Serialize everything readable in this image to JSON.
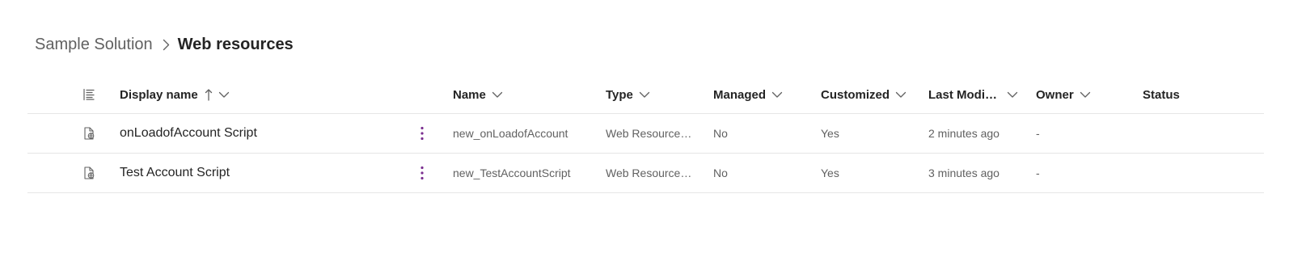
{
  "breadcrumb": {
    "parent": "Sample Solution",
    "current": "Web resources"
  },
  "columns": {
    "display_name": "Display name",
    "name": "Name",
    "type": "Type",
    "managed": "Managed",
    "customized": "Customized",
    "last_modified": "Last Modif...",
    "owner": "Owner",
    "status": "Status"
  },
  "rows": [
    {
      "display_name": "onLoadofAccount Script",
      "name": "new_onLoadofAccount",
      "type": "Web Resource (J...",
      "managed": "No",
      "customized": "Yes",
      "last_modified": "2 minutes ago",
      "owner": "-",
      "status": ""
    },
    {
      "display_name": "Test Account Script",
      "name": "new_TestAccountScript",
      "type": "Web Resource (J...",
      "managed": "No",
      "customized": "Yes",
      "last_modified": "3 minutes ago",
      "owner": "-",
      "status": ""
    }
  ],
  "icons": {
    "breadcrumb_separator": "chevron-right-icon",
    "column_options": "list-icon",
    "sort": "arrow-up-icon",
    "column_menu": "chevron-down-icon",
    "row_type": "web-resource-file-icon",
    "row_more": "more-vertical-icon"
  },
  "colors": {
    "accent": "#7a2e8f",
    "text_primary": "#242424",
    "text_secondary": "#616161",
    "divider": "#e6e6e6"
  }
}
